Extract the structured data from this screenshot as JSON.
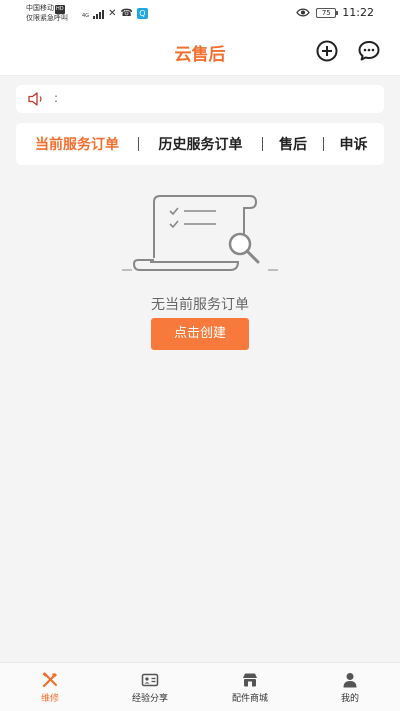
{
  "status_bar": {
    "carrier_line1": "中国移动",
    "hd_badge": "HD",
    "carrier_line2": "仅限紧急呼叫",
    "network_small": "4G",
    "app_badge": "Q",
    "battery_level": "75",
    "time": "11:22"
  },
  "header": {
    "title": "云售后"
  },
  "notice": {
    "text": ":"
  },
  "tabs": [
    {
      "label": "当前服务订单",
      "active": true
    },
    {
      "label": "历史服务订单",
      "active": false
    },
    {
      "label": "售后",
      "active": false
    },
    {
      "label": "申诉",
      "active": false
    }
  ],
  "empty_state": {
    "message": "无当前服务订单",
    "button_label": "点击创建"
  },
  "bottom_nav": [
    {
      "label": "维修",
      "icon": "repair-tools-icon",
      "active": true
    },
    {
      "label": "经验分享",
      "icon": "id-card-icon",
      "active": false
    },
    {
      "label": "配件商城",
      "icon": "store-icon",
      "active": false
    },
    {
      "label": "我的",
      "icon": "person-icon",
      "active": false
    }
  ],
  "colors": {
    "accent": "#f26f2e",
    "button": "#f7793b",
    "background": "#f4f4f4"
  }
}
